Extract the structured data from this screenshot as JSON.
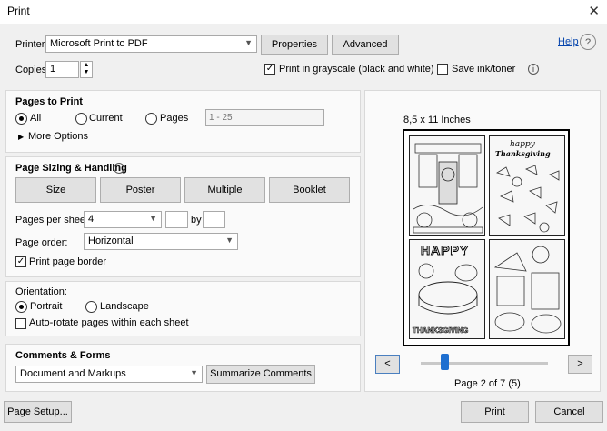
{
  "window": {
    "title": "Print",
    "close_icon": "✕"
  },
  "printer": {
    "label": "Printer:",
    "value": "Microsoft Print to PDF",
    "properties_label": "Properties",
    "advanced_label": "Advanced",
    "help_label": "Help"
  },
  "copies": {
    "label": "Copies:",
    "value": "1"
  },
  "options": {
    "grayscale_label": "Print in grayscale (black and white)",
    "grayscale_checked": true,
    "save_ink_label": "Save ink/toner",
    "save_ink_checked": false,
    "info_glyph": "i"
  },
  "pages_to_print": {
    "heading": "Pages to Print",
    "all_label": "All",
    "current_label": "Current",
    "pages_label": "Pages",
    "pages_placeholder": "1 - 25",
    "selected": "All",
    "more_options_label": "More Options"
  },
  "sizing": {
    "heading": "Page Sizing & Handling",
    "tabs": [
      "Size",
      "Poster",
      "Multiple",
      "Booklet"
    ],
    "pages_per_sheet_label": "Pages per sheet:",
    "pages_per_sheet_value": "4",
    "by_label": "by",
    "page_order_label": "Page order:",
    "page_order_value": "Horizontal",
    "border_label": "Print page border",
    "border_checked": true
  },
  "orientation": {
    "heading": "Orientation:",
    "portrait_label": "Portrait",
    "landscape_label": "Landscape",
    "selected": "Portrait",
    "autorotate_label": "Auto-rotate pages within each sheet",
    "autorotate_checked": false
  },
  "comments": {
    "heading": "Comments & Forms",
    "value": "Document and Markups",
    "summarize_label": "Summarize Comments"
  },
  "preview": {
    "size_label": "8,5 x 11 Inches",
    "happy_text": "HAPPY",
    "thanksgiving_text": "THANKSGIVING",
    "script_text_1": "happy",
    "script_text_2": "Thanksgiving",
    "prev_label": "<",
    "next_label": ">",
    "page_info": "Page 2 of 7 (5)",
    "current_page": 2,
    "total_pages": 7
  },
  "footer": {
    "page_setup_label": "Page Setup...",
    "print_label": "Print",
    "cancel_label": "Cancel"
  }
}
